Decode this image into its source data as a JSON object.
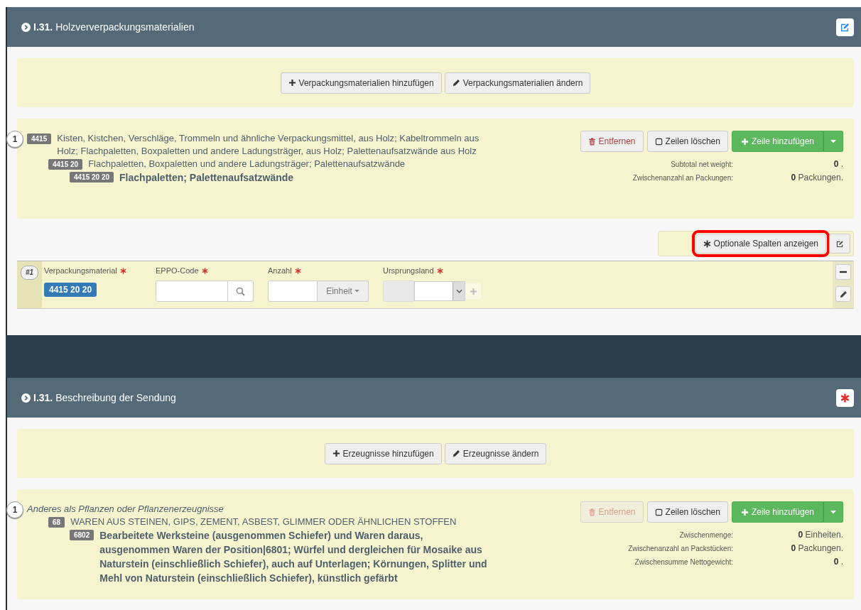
{
  "sections": [
    {
      "number": "I.31.",
      "title": "Holzververpackungsmaterialien",
      "required": false,
      "toolbar": [
        {
          "label": "Verpackungsmaterialien hinzufügen"
        },
        {
          "label": "Verpackungsmaterialien ändern"
        }
      ],
      "item": {
        "index": "1",
        "lines": [
          {
            "kind": "normal",
            "code": "4415",
            "text": "Kisten, Kistchen, Verschläge, Trommeln und ähnliche Verpackungsmittel, aus Holz; Kabeltrommeln aus Holz; Flachpaletten, Boxpaletten und andere Ladungsträger, aus Holz; Palettenaufsatzwände aus Holz",
            "children": [
              {
                "kind": "normal",
                "code": "4415 20",
                "text": "Flachpaletten, Boxpaletten und andere Ladungsträger; Palettenaufsatzwände",
                "children": [
                  {
                    "kind": "bold",
                    "code": "4415 20 20",
                    "text": "Flachpaletten; Palettenaufsatzwände"
                  }
                ]
              }
            ]
          }
        ],
        "remove": {
          "label": "Entfernen",
          "disabled": false
        },
        "clear": {
          "label": "Zeilen löschen"
        },
        "add": {
          "label": "Zeile hinzufügen"
        },
        "totals": [
          {
            "label": "Subtotal net weight:",
            "value": "**0** ."
          },
          {
            "label": "Zwischenanzahl an Packungen:",
            "value": "**0** Packungen."
          }
        ]
      },
      "optional_columns": {
        "label": "Optionale Spalten anzeigen",
        "highlighted": true
      },
      "rows": [
        {
          "number": "#1",
          "fields": [
            {
              "kind": "tag",
              "label": "Verpackungsmaterial",
              "required": true,
              "value": "4415 20 20"
            },
            {
              "kind": "search",
              "label": "EPPO-Code",
              "required": true
            },
            {
              "kind": "unit",
              "label": "Anzahl",
              "required": true,
              "unit": "Einheit"
            },
            {
              "kind": "select",
              "label": "Ursprungsland",
              "required": true
            }
          ]
        }
      ]
    },
    {
      "number": "I.31.",
      "title": "Beschreibung der Sendung",
      "required": true,
      "toolbar": [
        {
          "label": "Erzeugnisse hinzufügen"
        },
        {
          "label": "Erzeugnisse ändern"
        }
      ],
      "item": {
        "index": "1",
        "lines": [
          {
            "kind": "italic",
            "text": "Anderes als Pflanzen oder Pflanzenerzeugnisse",
            "children": [
              {
                "kind": "normal",
                "code": "68",
                "text": "WAREN AUS STEINEN, GIPS, ZEMENT, ASBEST, GLIMMER ODER ÄHNLICHEN STOFFEN",
                "children": [
                  {
                    "kind": "bold",
                    "code": "6802",
                    "text": "Bearbeitete Werksteine (ausgenommen Schiefer) und Waren daraus, ausgenommen Waren der Position|6801; Würfel und dergleichen für Mosaike aus Naturstein (einschließlich Schiefer), auch auf Unterlagen; Körnungen, Splitter und Mehl von Naturstein (einschließlich Schiefer), künstlich gefärbt"
                  }
                ]
              }
            ]
          }
        ],
        "remove": {
          "label": "Entfernen",
          "disabled": true
        },
        "clear": {
          "label": "Zeilen löschen"
        },
        "add": {
          "label": "Zeile hinzufügen"
        },
        "totals": [
          {
            "label": "Zwischenmenge:",
            "value": "**0** Einheiten."
          },
          {
            "label": "Zwischenanzahl an Packstücken:",
            "value": "**0** Packungen."
          },
          {
            "label": "Zwischensumme Nettogewicht:",
            "value": "**0** ."
          }
        ]
      }
    }
  ]
}
